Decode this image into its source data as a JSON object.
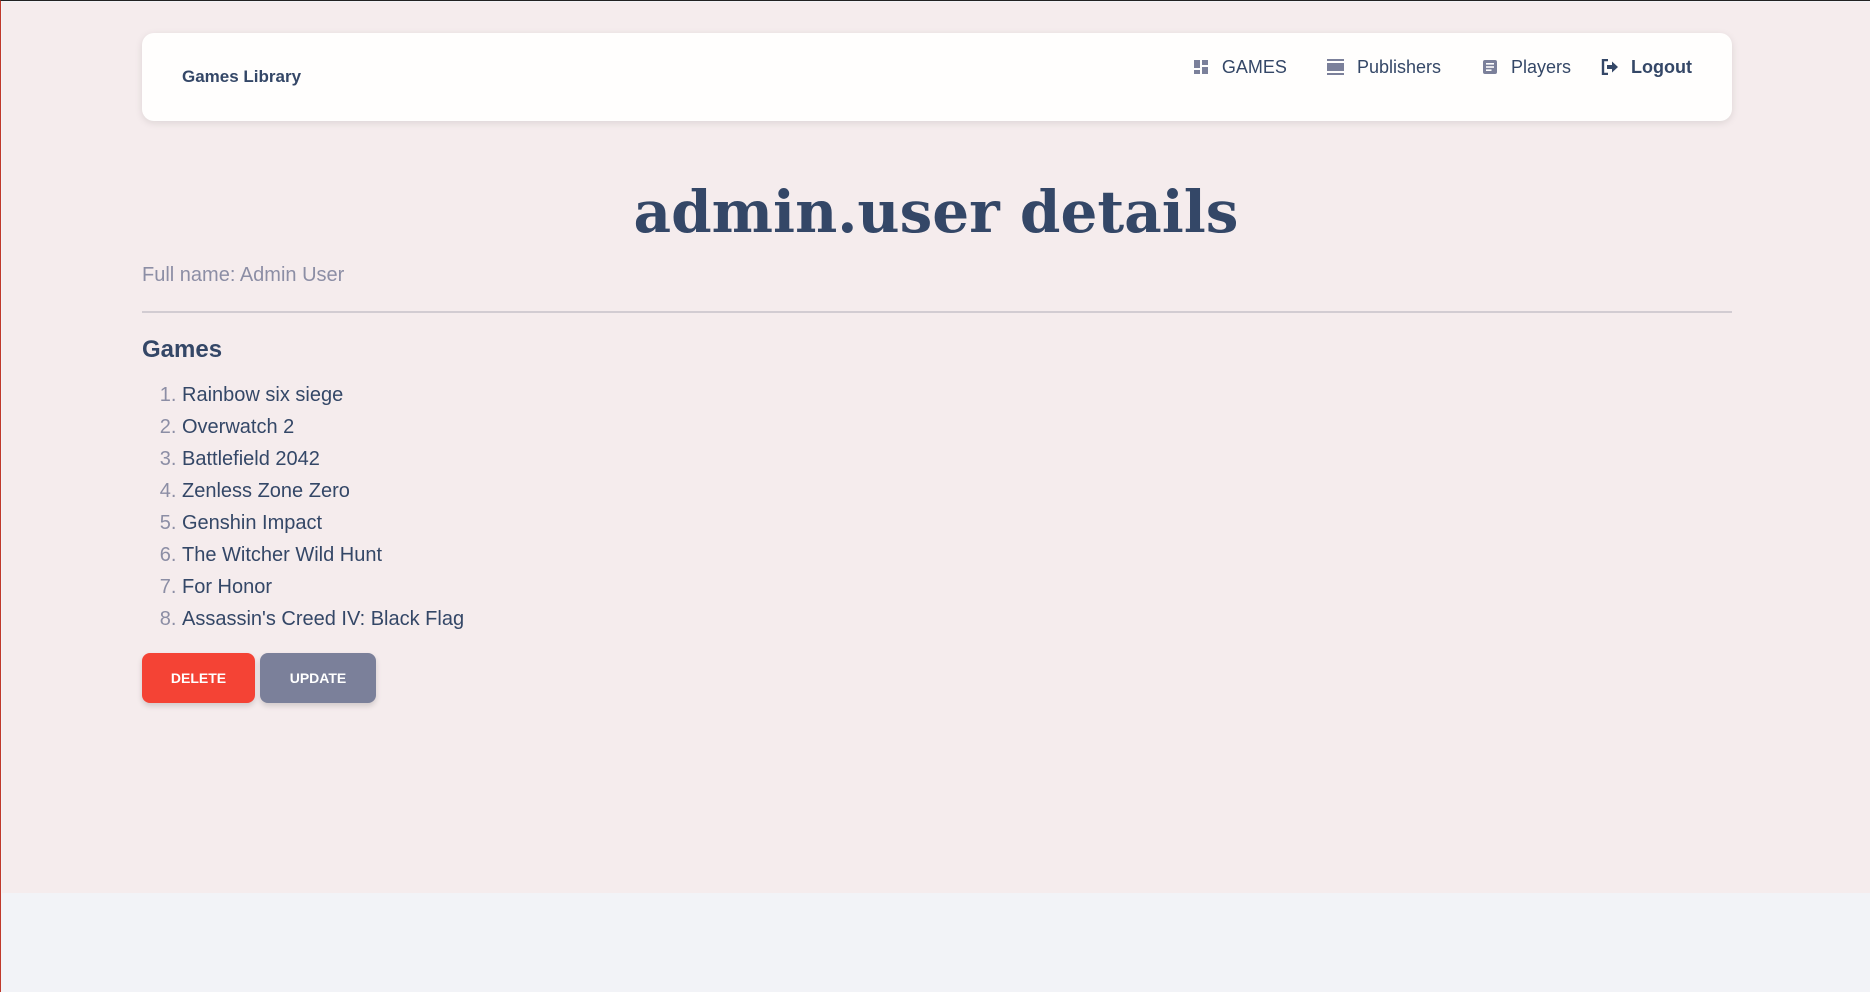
{
  "navbar": {
    "brand": "Games Library",
    "links": [
      {
        "label": "GAMES",
        "icon": "dashboard-icon"
      },
      {
        "label": "Publishers",
        "icon": "view-day-icon"
      },
      {
        "label": "Players",
        "icon": "article-icon"
      },
      {
        "label": "Logout",
        "icon": "logout-icon"
      }
    ]
  },
  "main": {
    "title": "admin.user details",
    "full_name": "Full name: Admin User",
    "games_heading": "Games",
    "games": [
      "Rainbow six siege",
      "Overwatch 2",
      "Battlefield 2042",
      "Zenless Zone Zero",
      "Genshin Impact",
      "The Witcher Wild Hunt",
      "For Honor",
      "Assassin's Creed IV: Black Flag"
    ],
    "delete_label": "DELETE",
    "update_label": "UPDATE"
  },
  "colors": {
    "text": "#344767",
    "muted": "#8c8ea5",
    "delete": "#f44335",
    "update": "#7b809a",
    "page_bg": "#f5eced"
  }
}
